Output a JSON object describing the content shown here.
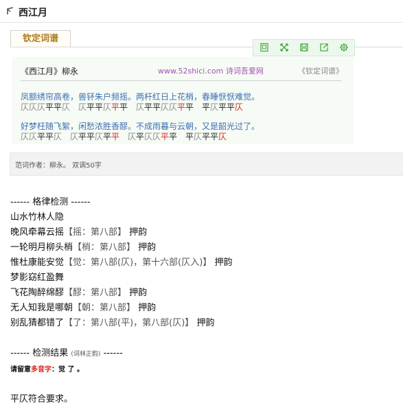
{
  "header": {
    "title": "西江月"
  },
  "tab": {
    "label": "钦定词谱"
  },
  "toolbar": {
    "buttons": [
      {
        "name": "doc-icon"
      },
      {
        "name": "expand-icon"
      },
      {
        "name": "save-icon"
      },
      {
        "name": "share-icon"
      },
      {
        "name": "gear-icon"
      }
    ]
  },
  "poem": {
    "title": "《西江月》柳永",
    "site": "www.52shici.com 诗词吾爱网",
    "cipu": "《钦定词谱》",
    "lines": [
      {
        "text": "凤额绣帘高卷，兽钚朱户频摇。两杆红日上花梢，春睡恹恹难觉。",
        "tones": [
          "仄",
          "仄",
          "仄",
          "平",
          "平",
          "仄",
          "gap",
          "仄",
          "平",
          "平",
          "仄",
          "平",
          "平",
          "gap",
          "仄",
          "平",
          "平",
          "仄",
          "仄",
          "平",
          "平",
          "gap",
          "平",
          "仄",
          "平",
          "平",
          "仄"
        ],
        "red": [
          11,
          19,
          26
        ]
      },
      {
        "text": "好梦枉随飞絮，闲愁浓胜香醪。不成雨暮与云朝，又是韶光过了。",
        "tones": [
          "仄",
          "仄",
          "平",
          "平",
          "仄",
          "gap",
          "仄",
          "平",
          "平",
          "仄",
          "平",
          "平",
          "gap",
          "仄",
          "平",
          "仄",
          "仄",
          "平",
          "平",
          "gap",
          "平",
          "仄",
          "平",
          "平",
          "仄"
        ],
        "red": [
          11,
          17,
          24
        ]
      }
    ]
  },
  "info": {
    "text": "范词作者：柳永。 双调50字"
  },
  "check": {
    "header": "------ 格律检测 ------",
    "rows": [
      {
        "text": "山水竹林人隐",
        "rhyme": "",
        "mark": ""
      },
      {
        "text": "晚风牵幕云摇",
        "rhyme": "【摇：第八部】",
        "mark": "押韵"
      },
      {
        "text": "一轮明月柳头梢",
        "rhyme": "【梢：第八部】",
        "mark": "押韵"
      },
      {
        "text": "惟杜康能安觉",
        "rhyme": "【觉：第八部(仄)，第十六部(仄入)】",
        "mark": "押韵"
      },
      {
        "text": "梦影窈红盈舞",
        "rhyme": "",
        "mark": ""
      },
      {
        "text": "飞花陶醉绵醪",
        "rhyme": "【醪：第八部】",
        "mark": "押韵"
      },
      {
        "text": "无人知我是哪朝",
        "rhyme": "【朝：第八部】",
        "mark": "押韵"
      },
      {
        "text": "别乱猜都错了",
        "rhyme": "【了：第八部(平)，第八部(仄)】",
        "mark": "押韵"
      }
    ],
    "result_header_left": "------ 检测结果",
    "result_header_small": "(词林正韵)",
    "result_header_right": "------",
    "warn_prefix": "请留意",
    "warn_red": "多音字",
    "warn_suffix": "：觉 了 。",
    "conclusion": "平仄符合要求。"
  }
}
